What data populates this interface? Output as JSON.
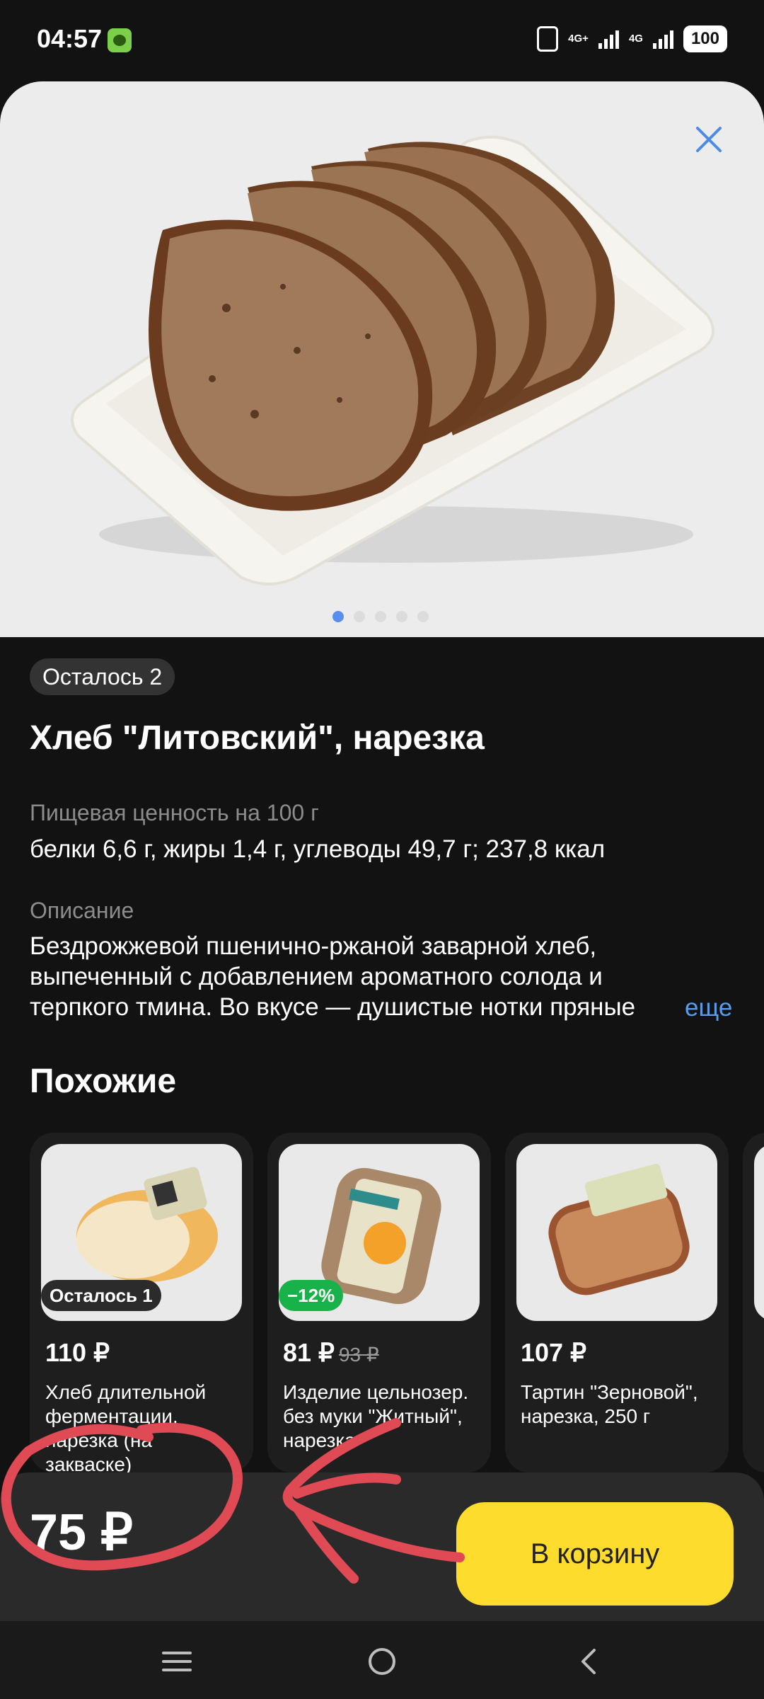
{
  "status": {
    "time": "04:57",
    "net1": "4G+",
    "net2": "4G",
    "battery": "100"
  },
  "product": {
    "stock_badge": "Осталось 2",
    "title": "Хлеб \"Литовский\", нарезка",
    "nutrition_label": "Пищевая ценность на 100 г",
    "nutrition_value": "белки 6,6 г, жиры 1,4 г, углеводы 49,7 г; 237,8 ккал",
    "description_label": "Описание",
    "description_line1": "Бездрожжевой пшенично-ржаной заварной хлеб,",
    "description_line2": "выпеченный с добавлением ароматного солода и",
    "description_line3": "терпкого тмина. Во вкусе — душистые нотки пряные",
    "more_link": "еще",
    "image_pages": 5,
    "active_page": 1
  },
  "similar": {
    "title": "Похожие",
    "items": [
      {
        "tag": "Осталось 1",
        "price": "110 ₽",
        "old_price": "",
        "name": "Хлеб длительной ферментации, нарезка (на закваске)"
      },
      {
        "tag": "−12%",
        "price": "81 ₽",
        "old_price": "93 ₽",
        "name": "Изделие цельнозер. без муки \"Житный\", нарезка"
      },
      {
        "tag": "",
        "price": "107 ₽",
        "old_price": "",
        "name": "Тартин \"Зерновой\", нарезка, 250 г"
      }
    ]
  },
  "footer": {
    "price": "75 ₽",
    "cart_button": "В корзину"
  },
  "colors": {
    "accent_button": "#fedc2e",
    "link": "#5a9be8",
    "discount": "#19b24a",
    "annotation": "#e04a55"
  }
}
